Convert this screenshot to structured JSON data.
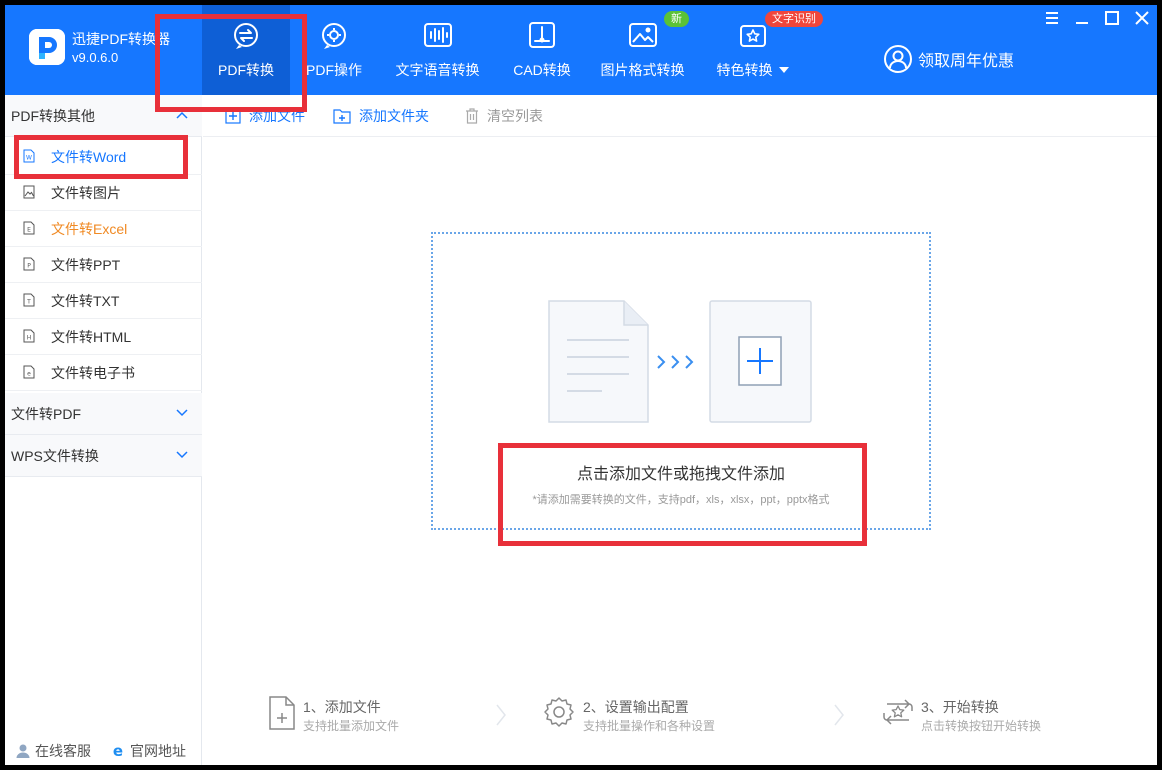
{
  "app": {
    "name": "迅捷PDF转换器",
    "version": "v9.0.6.0"
  },
  "nav": [
    {
      "label": "PDF转换",
      "icon": "pdf-convert-icon",
      "active": true
    },
    {
      "label": "PDF操作",
      "icon": "pdf-operation-icon",
      "active": false
    },
    {
      "label": "文字语音转换",
      "icon": "text-speech-icon",
      "active": false
    },
    {
      "label": "CAD转换",
      "icon": "cad-convert-icon",
      "active": false
    },
    {
      "label": "图片格式转换",
      "icon": "image-format-icon",
      "active": false,
      "badge": "新"
    },
    {
      "label": "特色转换",
      "icon": "special-convert-icon",
      "active": false,
      "badge": "文字识别"
    }
  ],
  "promo": {
    "label": "领取周年优惠"
  },
  "sidebar": {
    "sections": [
      {
        "label": "PDF转换其他",
        "expanded": true
      },
      {
        "label": "文件转PDF",
        "expanded": false
      },
      {
        "label": "WPS文件转换",
        "expanded": false
      }
    ],
    "items": [
      {
        "label": "文件转Word",
        "icon": "word-file-icon",
        "glyph": "W",
        "state": "selected"
      },
      {
        "label": "文件转图片",
        "icon": "image-file-icon",
        "glyph": "",
        "state": "normal"
      },
      {
        "label": "文件转Excel",
        "icon": "excel-file-icon",
        "glyph": "E",
        "state": "hover"
      },
      {
        "label": "文件转PPT",
        "icon": "ppt-file-icon",
        "glyph": "P",
        "state": "normal"
      },
      {
        "label": "文件转TXT",
        "icon": "txt-file-icon",
        "glyph": "T",
        "state": "normal"
      },
      {
        "label": "文件转HTML",
        "icon": "html-file-icon",
        "glyph": "H",
        "state": "normal"
      },
      {
        "label": "文件转电子书",
        "icon": "ebook-file-icon",
        "glyph": "e",
        "state": "normal"
      }
    ],
    "footer": {
      "support": "在线客服",
      "website": "官网地址"
    }
  },
  "toolbar": {
    "add_file": "添加文件",
    "add_folder": "添加文件夹",
    "clear_list": "清空列表"
  },
  "dropzone": {
    "title": "点击添加文件或拖拽文件添加",
    "subtitle": "*请添加需要转换的文件，支持pdf，xls，xlsx，ppt，pptx格式"
  },
  "steps": [
    {
      "title": "1、添加文件",
      "subtitle": "支持批量添加文件"
    },
    {
      "title": "2、设置输出配置",
      "subtitle": "支持批量操作和各种设置"
    },
    {
      "title": "3、开始转换",
      "subtitle": "点击转换按钮开始转换"
    }
  ],
  "colors": {
    "brand": "#1677ff",
    "brand_active": "#0e5fd6",
    "highlight": "#e8303a",
    "excel_orange": "#f08a24",
    "badge_new": "#5bc236",
    "badge_ocr": "#f0463c"
  }
}
